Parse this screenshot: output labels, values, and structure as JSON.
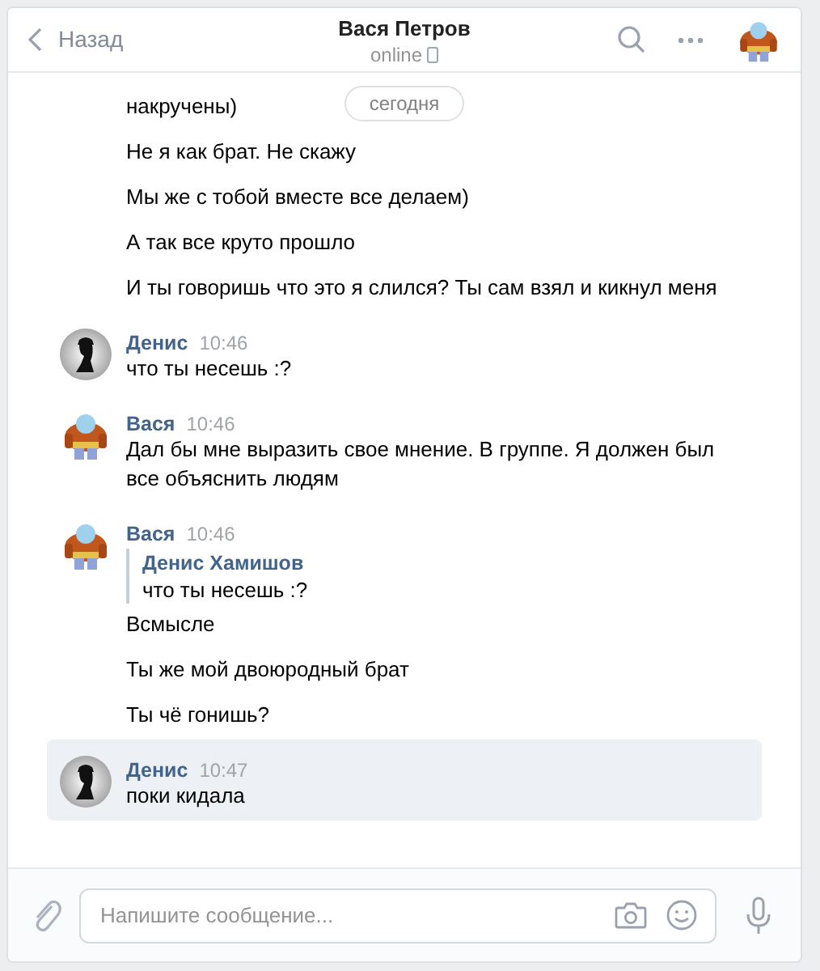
{
  "header": {
    "back_label": "Назад",
    "title": "Вася Петров",
    "status": "online"
  },
  "date_pill": "сегодня",
  "groups": [
    {
      "messages": [
        "накручены)",
        "Не я как брат. Не скажу",
        "Мы же с тобой вместе все делаем)",
        "А так все круто прошло",
        "И ты говоришь что это я слился? Ты сам взял и кикнул меня"
      ],
      "selected": false
    },
    {
      "avatar": {
        "kind": "silhouette"
      },
      "author": "Денис",
      "time": "10:46",
      "messages": [
        "что ты несешь :?"
      ],
      "selected": false
    },
    {
      "avatar": {
        "kind": "fighter"
      },
      "author": "Вася",
      "time": "10:46",
      "messages": [
        "Дал бы мне выразить свое мнение. В группе. Я должен был все объяснить людям"
      ],
      "selected": false
    },
    {
      "avatar": {
        "kind": "fighter"
      },
      "author": "Вася",
      "time": "10:46",
      "reply": {
        "author": "Денис Хамишов",
        "text": "что ты несешь :?"
      },
      "messages": [
        "Всмысле",
        "Ты же мой двоюродный брат",
        "Ты чё гонишь?"
      ],
      "selected": false
    },
    {
      "avatar": {
        "kind": "silhouette"
      },
      "author": "Денис",
      "time": "10:47",
      "messages": [
        "поки кидала"
      ],
      "selected": true
    }
  ],
  "composer": {
    "placeholder": "Напишите сообщение..."
  }
}
